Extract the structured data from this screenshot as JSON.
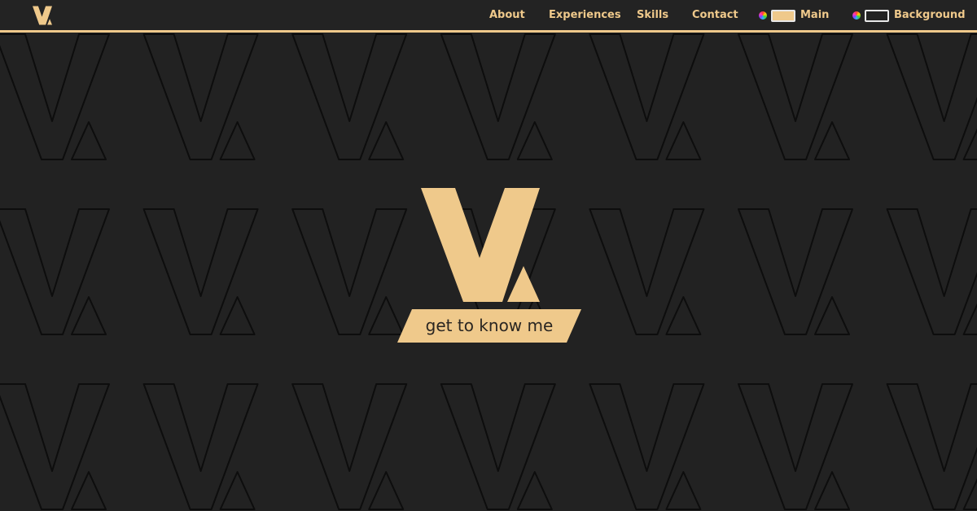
{
  "theme": {
    "accent": "#efc98b",
    "background": "#222222",
    "pattern_stroke": "#0d0d0d"
  },
  "nav": {
    "logo_icon": "v-logo-icon",
    "links": [
      "About",
      "Experiences",
      "Skills",
      "Contact"
    ],
    "color_pickers": [
      {
        "icon": "color-wheel-icon",
        "swatch_color": "#efc98b",
        "label": "Main"
      },
      {
        "icon": "color-wheel-icon",
        "swatch_color": "#222222",
        "label": "Background"
      }
    ]
  },
  "hero": {
    "logo_icon": "v-logo-icon",
    "cta_label": "get to know me"
  }
}
